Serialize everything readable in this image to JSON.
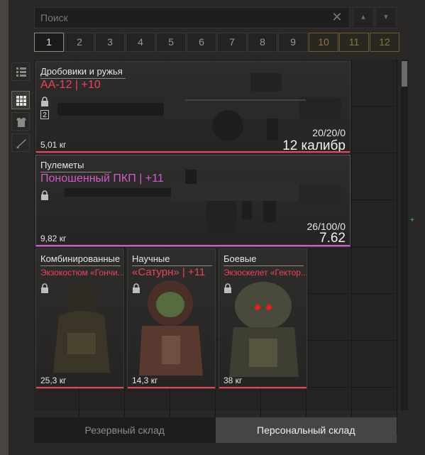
{
  "search": {
    "placeholder": "Поиск"
  },
  "pages": [
    "1",
    "2",
    "3",
    "4",
    "5",
    "6",
    "7",
    "8",
    "9",
    "10",
    "11",
    "12"
  ],
  "active_page": "1",
  "locked_pages": [
    "10",
    "11",
    "12"
  ],
  "items": [
    {
      "category": "Дробовики и ружья",
      "name": "АА-12 | +10",
      "badge": "2",
      "ammo": "20/20/0",
      "caliber": "12 калибр",
      "weight": "5,01 кг",
      "name_color": "#e9445c"
    },
    {
      "category": "Пулеметы",
      "name": "Поношенный ПКП | +11",
      "ammo": "26/100/0",
      "caliber": "7.62",
      "weight": "9,82 кг",
      "name_color": "#d05ac8"
    },
    {
      "category": "Комбинированные",
      "name": "Экзокостюм «Гончи...",
      "weight": "25,3 кг",
      "name_color": "#e9445c"
    },
    {
      "category": "Научные",
      "name": "«Сатурн» | +11",
      "weight": "14,3 кг",
      "name_color": "#e9445c"
    },
    {
      "category": "Боевые",
      "name": "Экзоскелет «Гектор...",
      "weight": "38 кг",
      "name_color": "#e9445c"
    }
  ],
  "tabs": {
    "reserve": "Резервный склад",
    "personal": "Персональный склад"
  },
  "colors": {
    "accent_red": "#e9445c",
    "accent_purple": "#d05ac8",
    "locked_gold": "#8b7547"
  }
}
